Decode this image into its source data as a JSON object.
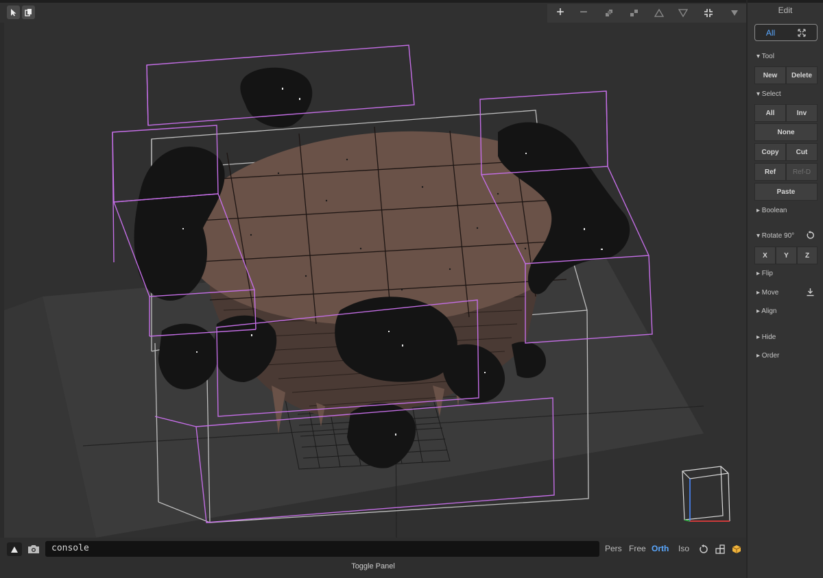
{
  "toolbar": {
    "left_tools": [
      "select-tool",
      "copy-tool"
    ],
    "right_tools": [
      "+",
      "−",
      "▞",
      "▚",
      "△",
      "▽",
      "⤧",
      "▼"
    ]
  },
  "panel": {
    "title": "Edit",
    "scope_all": "All",
    "sections": {
      "tool": "▾ Tool",
      "select": "▾ Select",
      "boolean": "▸ Boolean",
      "rotate": "▾ Rotate 90°",
      "flip": "▸ Flip",
      "move": "▸ Move",
      "align": "▸ Align",
      "hide": "▸ Hide",
      "order": "▸ Order"
    },
    "buttons": {
      "new": "New",
      "delete": "Delete",
      "all": "All",
      "inv": "Inv",
      "none": "None",
      "copy": "Copy",
      "cut": "Cut",
      "ref": "Ref",
      "ref_d": "Ref-D",
      "paste": "Paste",
      "x": "X",
      "y": "Y",
      "z": "Z"
    }
  },
  "bottom": {
    "console_value": "console",
    "views": {
      "pers": "Pers",
      "free": "Free",
      "orth": "Orth",
      "iso": "Iso"
    },
    "toggle_panel": "Toggle Panel"
  },
  "colors": {
    "accent": "#5aa8ff",
    "selection_box": "#c46ee6",
    "ground_box": "#bfbfbf",
    "disc_fill": "#6a5248",
    "foliage": "#141414"
  }
}
